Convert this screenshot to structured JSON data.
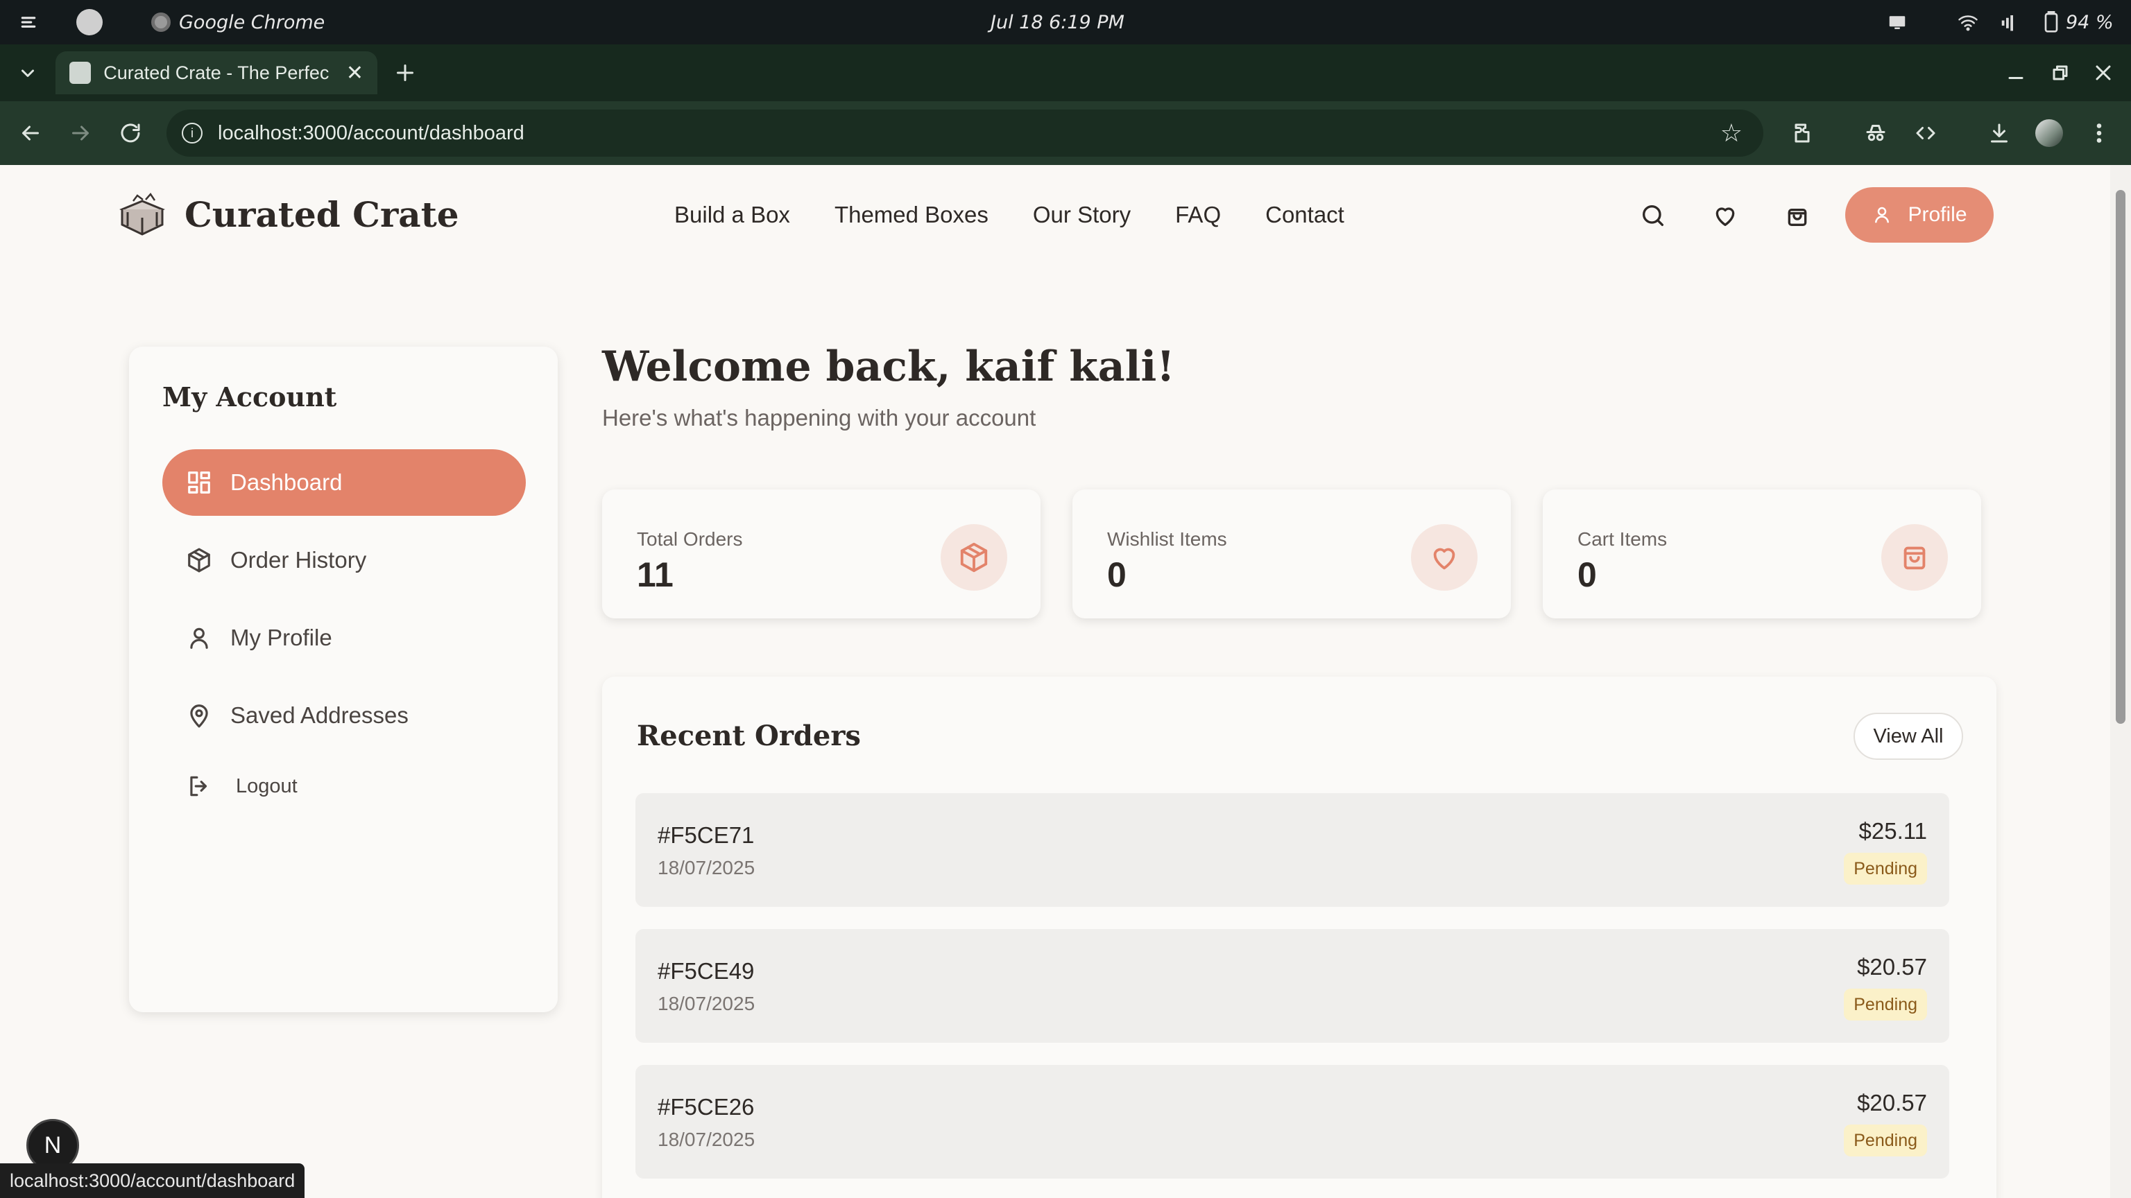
{
  "os": {
    "app_name": "Google Chrome",
    "datetime": "Jul 18   6:19 PM",
    "battery": "94 %"
  },
  "browser": {
    "tab_title": "Curated Crate - The Perfec",
    "url": "localhost:3000/account/dashboard"
  },
  "site": {
    "logo_text": "Curated Crate",
    "nav": [
      "Build a Box",
      "Themed Boxes",
      "Our Story",
      "FAQ",
      "Contact"
    ],
    "profile_label": "Profile",
    "accent_color": "#e3836a"
  },
  "sidebar": {
    "title": "My Account",
    "items": [
      {
        "label": "Dashboard",
        "icon": "grid-icon",
        "active": true
      },
      {
        "label": "Order History",
        "icon": "package-icon",
        "active": false
      },
      {
        "label": "My Profile",
        "icon": "user-icon",
        "active": false
      },
      {
        "label": "Saved Addresses",
        "icon": "map-pin-icon",
        "active": false
      },
      {
        "label": "Logout",
        "icon": "logout-icon",
        "active": false
      }
    ]
  },
  "main": {
    "welcome": "Welcome back, kaif kali!",
    "subtitle": "Here's what's happening with your account",
    "stats": [
      {
        "label": "Total Orders",
        "value": "11",
        "icon": "package-icon"
      },
      {
        "label": "Wishlist Items",
        "value": "0",
        "icon": "heart-icon"
      },
      {
        "label": "Cart Items",
        "value": "0",
        "icon": "bag-icon"
      }
    ],
    "recent_orders": {
      "title": "Recent Orders",
      "view_all": "View All",
      "orders": [
        {
          "id": "#F5CE71",
          "date": "18/07/2025",
          "price": "$25.11",
          "status": "Pending"
        },
        {
          "id": "#F5CE49",
          "date": "18/07/2025",
          "price": "$20.57",
          "status": "Pending"
        },
        {
          "id": "#F5CE26",
          "date": "18/07/2025",
          "price": "$20.57",
          "status": "Pending"
        }
      ]
    }
  },
  "overlay": {
    "dev_badge": "N",
    "status_url": "localhost:3000/account/dashboard"
  }
}
